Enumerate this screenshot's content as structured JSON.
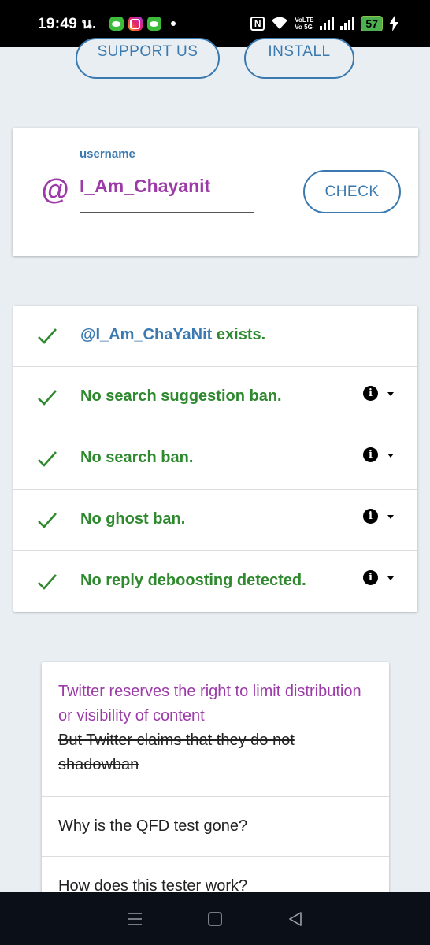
{
  "status_bar": {
    "time": "19:49 น.",
    "battery": "57",
    "volte_line1": "VoLTE",
    "volte_line2": "Vo 5G",
    "nfc": "N"
  },
  "top_buttons": {
    "support": "SUPPORT US",
    "install": "INSTALL"
  },
  "username_card": {
    "at_symbol": "@",
    "label": "username",
    "value": "I_Am_Chayanit",
    "check_button": "CHECK"
  },
  "results": [
    {
      "username": "@I_Am_ChaYaNit",
      "text": "exists.",
      "has_info": false
    },
    {
      "text": "No search suggestion ban.",
      "has_info": true
    },
    {
      "text": "No search ban.",
      "has_info": true
    },
    {
      "text": "No ghost ban.",
      "has_info": true
    },
    {
      "text": "No reply deboosting detected.",
      "has_info": true
    }
  ],
  "faq": {
    "first": {
      "highlight": "Twitter reserves the right to limit distribution or visibility of content",
      "struck": "But Twitter claims that they do not shadowban"
    },
    "items": [
      "Why is the QFD test gone?",
      "How does this tester work?"
    ]
  },
  "colors": {
    "accent_blue": "#3a7ab0",
    "purple": "#9c3aa8",
    "success_green": "#2f8a2f",
    "background": "#e9eef2"
  },
  "icons": {
    "nav_recents": "menu-icon",
    "nav_home": "square-icon",
    "nav_back": "triangle-back-icon",
    "result_status": "checkmark-icon",
    "result_info": "info-icon",
    "result_expand": "caret-down-icon"
  }
}
